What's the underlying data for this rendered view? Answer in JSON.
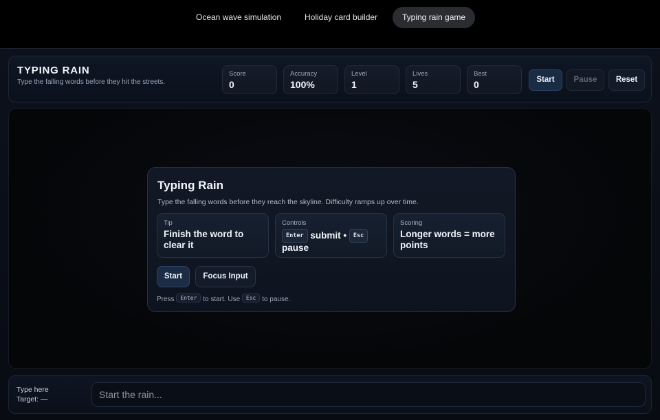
{
  "tabs": [
    {
      "label": "Ocean wave simulation"
    },
    {
      "label": "Holiday card builder"
    },
    {
      "label": "Typing rain game",
      "active": true
    }
  ],
  "header": {
    "title": "TYPING RAIN",
    "subtitle": "Type the falling words before they hit the streets.",
    "stats": [
      {
        "label": "Score",
        "value": "0"
      },
      {
        "label": "Accuracy",
        "value": "100%"
      },
      {
        "label": "Level",
        "value": "1"
      },
      {
        "label": "Lives",
        "value": "5"
      },
      {
        "label": "Best",
        "value": "0"
      }
    ],
    "buttons": {
      "start": "Start",
      "pause": "Pause",
      "reset": "Reset"
    }
  },
  "overlay": {
    "title": "Typing Rain",
    "description": "Type the falling words before they reach the skyline. Difficulty ramps up over time.",
    "tip": {
      "label": "Tip",
      "text": "Finish the word to clear it"
    },
    "controls": {
      "label": "Controls",
      "key_submit": "Enter",
      "submit_text": "submit •",
      "key_pause": "Esc",
      "pause_text": "pause"
    },
    "scoring": {
      "label": "Scoring",
      "text": "Longer words = more points"
    },
    "start_button": "Start",
    "focus_button": "Focus Input",
    "hint": {
      "press": "Press",
      "key_start": "Enter",
      "to_start": "to start. Use",
      "key_pause": "Esc",
      "to_pause": "to pause."
    }
  },
  "footer": {
    "label": "Type here",
    "target": "Target: —",
    "input_placeholder": "Start the rain...",
    "input_value": ""
  },
  "colors": {
    "background": "#000000",
    "panel": "#0f1624",
    "accent_button": "#1a2b44"
  }
}
